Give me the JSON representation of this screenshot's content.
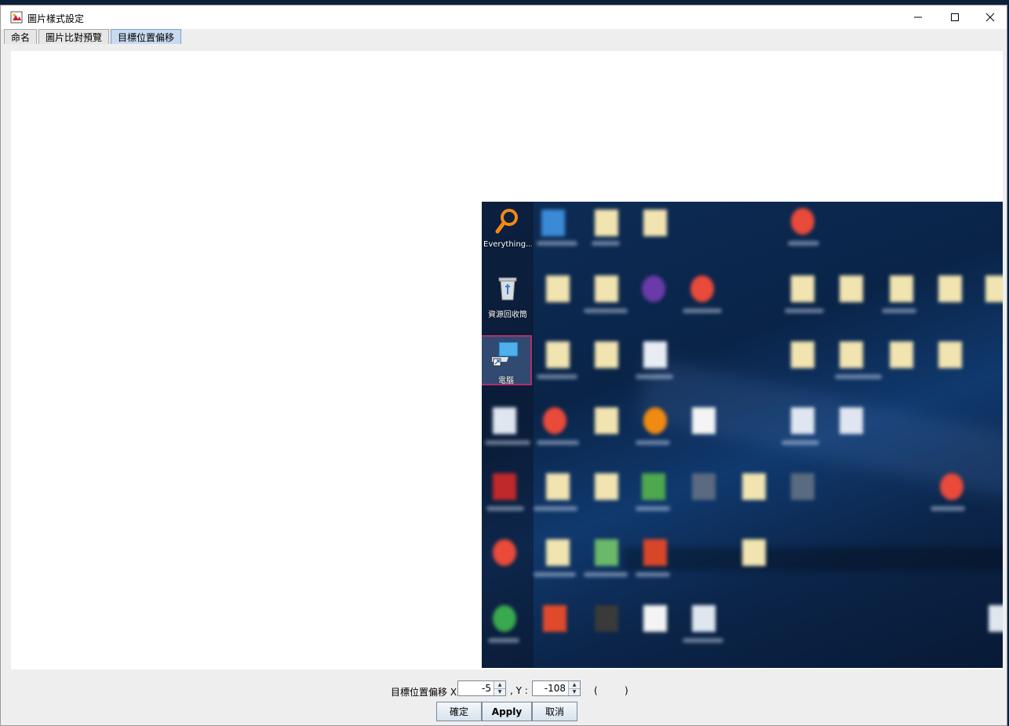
{
  "window": {
    "title": "圖片樣式設定"
  },
  "tabs": [
    {
      "label": "命名"
    },
    {
      "label": "圖片比對預覽"
    },
    {
      "label": "目標位置偏移",
      "active": true
    }
  ],
  "preview": {
    "icons": [
      {
        "label": "Everything...",
        "icon": "magnifier-icon"
      },
      {
        "label": "資源回收筒",
        "icon": "recycle-bin-icon"
      },
      {
        "label": "電腦",
        "icon": "computer-icon",
        "selected": true
      }
    ]
  },
  "offset": {
    "label": "目標位置偏移 X:",
    "x_value": "-5",
    "y_label": ", Y :",
    "y_value": "-108",
    "paren": "(         )"
  },
  "buttons": {
    "ok": "確定",
    "apply": "Apply",
    "cancel": "取消"
  },
  "colors": {
    "selection": "#b0306a",
    "active_tab": "#c8daf0"
  }
}
